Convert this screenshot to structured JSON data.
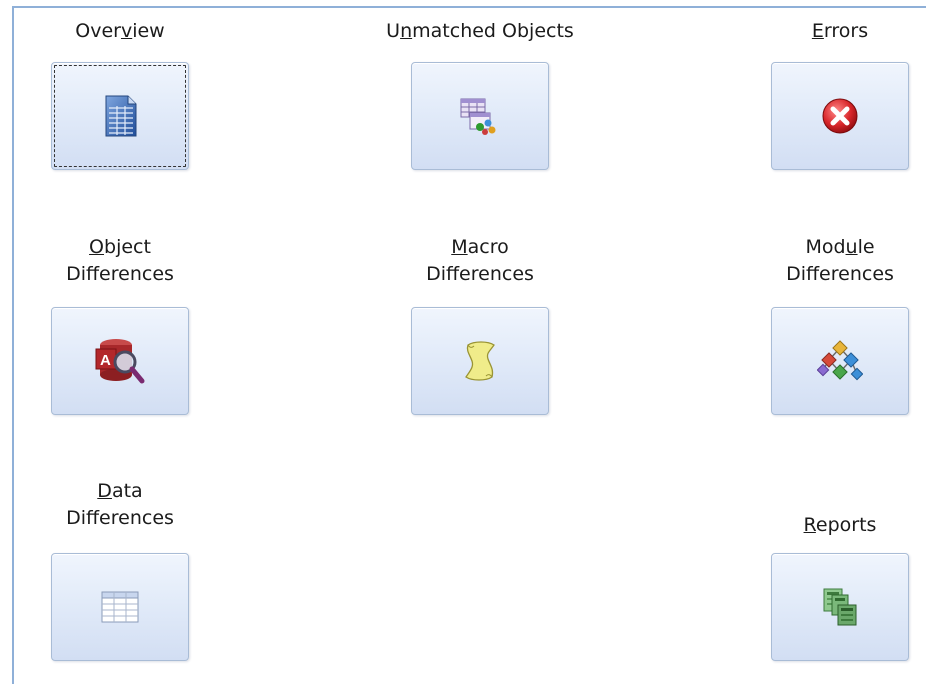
{
  "buttons": {
    "overview": {
      "before": "Over",
      "key": "v",
      "after": "iew"
    },
    "unmatched": {
      "before": "U",
      "key": "n",
      "after": "matched Objects"
    },
    "errors": {
      "before": "",
      "key": "E",
      "after": "rrors"
    },
    "object": {
      "line1_key": "O",
      "line1_rest": "bject",
      "line2": "Differences"
    },
    "macro": {
      "line1_key": "M",
      "line1_rest": "acro",
      "line2": "Differences"
    },
    "module": {
      "line1_before": "Mod",
      "line1_key": "u",
      "line1_after": "le",
      "line2": "Differences"
    },
    "data": {
      "line1_key": "D",
      "line1_rest": "ata",
      "line2": "Differences"
    },
    "reports": {
      "before": "",
      "key": "R",
      "after": "eports"
    }
  },
  "icons": {
    "overview": "document-table-icon",
    "unmatched": "table-relationship-icon",
    "errors": "red-x-error-icon",
    "object": "access-magnifier-icon",
    "macro": "scroll-macro-icon",
    "module": "module-diagram-icon",
    "data": "datasheet-grid-icon",
    "reports": "green-report-icon"
  },
  "colors": {
    "frame_border": "#8fb0d8",
    "tile_border": "#a9bcd6",
    "tile_gradient_top": "#f0f5fd",
    "tile_gradient_bottom": "#d2def3"
  }
}
